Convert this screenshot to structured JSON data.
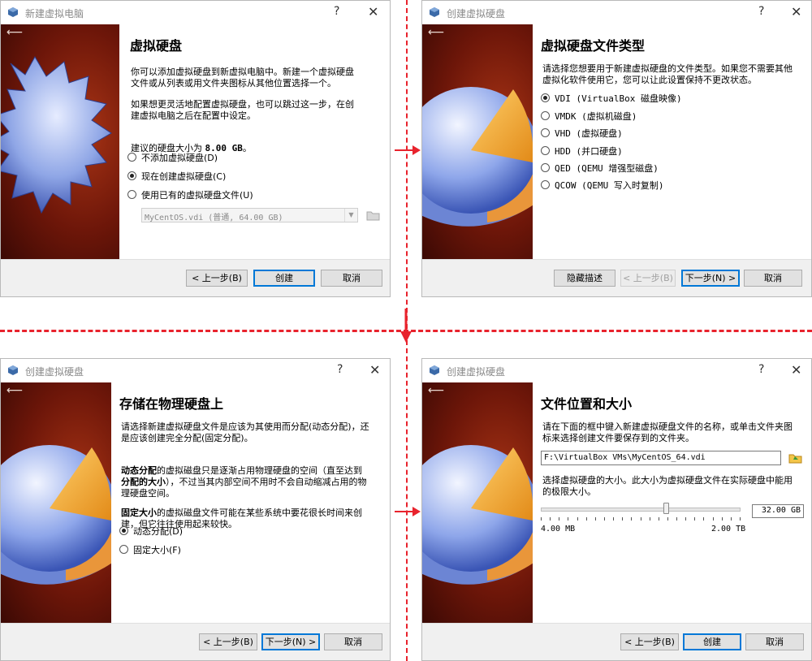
{
  "dialog1": {
    "title": "新建虚拟电脑",
    "help": "?",
    "close": "✕",
    "heading": "虚拟硬盘",
    "para1": "你可以添加虚拟硬盘到新虚拟电脑中。新建一个虚拟硬盘\n文件或从列表或用文件夹图标从其他位置选择一个。",
    "para2": "如果想更灵活地配置虚拟硬盘，也可以跳过这一步，在创\n建虚拟电脑之后在配置中设定。",
    "size_prefix": "建议的硬盘大小为 ",
    "size_value": "8.00 GB",
    "size_suffix": "。",
    "options": [
      "不添加虚拟硬盘(D)",
      "现在创建虚拟硬盘(C)",
      "使用已有的虚拟硬盘文件(U)"
    ],
    "selected_index": 1,
    "file_combo": "MyCentOS.vdi (普通, 64.00 GB)",
    "buttons": {
      "back": "< 上一步(B)",
      "create": "创建",
      "cancel": "取消"
    }
  },
  "dialog2": {
    "title": "创建虚拟硬盘",
    "help": "?",
    "close": "✕",
    "heading": "虚拟硬盘文件类型",
    "para": "请选择您想要用于新建虚拟硬盘的文件类型。如果您不需要其他\n虚拟化软件使用它，您可以让此设置保持不更改状态。",
    "options": [
      "VDI (VirtualBox 磁盘映像)",
      "VMDK (虚拟机磁盘)",
      "VHD (虚拟硬盘)",
      "HDD (并口硬盘)",
      "QED (QEMU 增强型磁盘)",
      "QCOW (QEMU 写入时复制)"
    ],
    "selected_index": 0,
    "buttons": {
      "hide": "隐藏描述",
      "back": "< 上一步(B)",
      "next": "下一步(N) >",
      "cancel": "取消"
    }
  },
  "dialog3": {
    "title": "创建虚拟硬盘",
    "help": "?",
    "close": "✕",
    "heading": "存储在物理硬盘上",
    "para1": "请选择新建虚拟硬盘文件是应该为其使用而分配(动态分配)，还\n是应该创建完全分配(固定分配)。",
    "para2_bold1": "动态分配",
    "para2_mid": "的虚拟磁盘只是逐渐占用物理硬盘的空间（直至达到",
    "para2_bold2": "分配的大小",
    "para2_rest": "），不过当其内部空间不用时不会自动缩减占用的物\n理硬盘空间。",
    "para3_bold": "固定大小",
    "para3_rest": "的虚拟磁盘文件可能在某些系统中要花很长时间来创\n建，但它往往使用起来较快。",
    "options": [
      "动态分配(D)",
      "固定大小(F)"
    ],
    "selected_index": 0,
    "buttons": {
      "back": "< 上一步(B)",
      "next": "下一步(N) >",
      "cancel": "取消"
    }
  },
  "dialog4": {
    "title": "创建虚拟硬盘",
    "help": "?",
    "close": "✕",
    "heading": "文件位置和大小",
    "para1": "请在下面的框中键入新建虚拟硬盘文件的名称，或单击文件夹图\n标来选择创建文件要保存到的文件夹。",
    "path_value": "F:\\VirtualBox VMs\\MyCentOS_64.vdi",
    "para2": "选择虚拟硬盘的大小。此大小为虚拟硬盘文件在实际硬盘中能用\n的极限大小。",
    "size_value": "32.00 GB",
    "slider_fraction": 0.63,
    "min_label": "4.00 MB",
    "max_label": "2.00 TB",
    "buttons": {
      "back": "< 上一步(B)",
      "create": "创建",
      "cancel": "取消"
    }
  },
  "colors": {
    "accent": "#0078d7",
    "divider": "#e8232d",
    "art_bg": "#6d1609"
  }
}
